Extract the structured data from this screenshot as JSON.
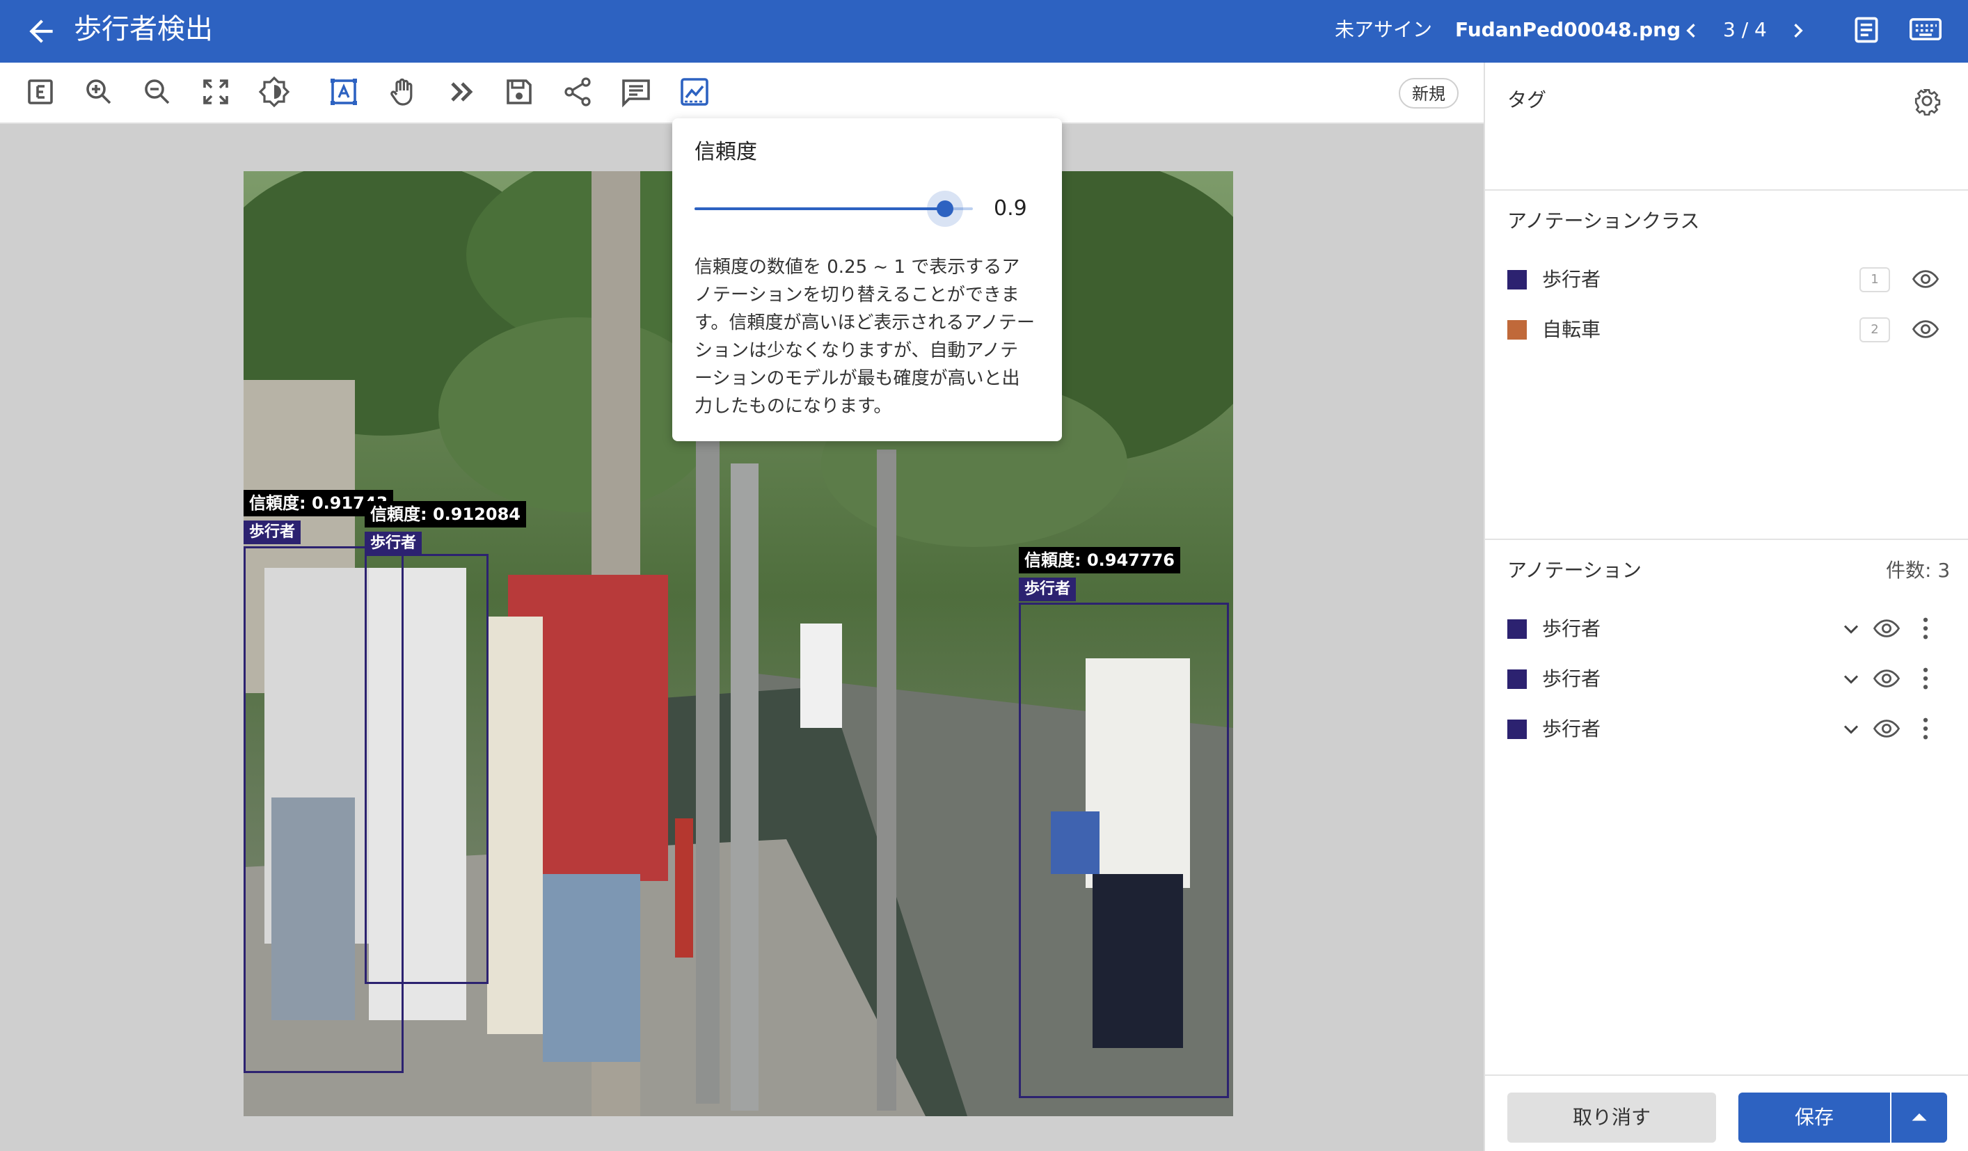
{
  "header": {
    "title": "歩行者検出",
    "assign_status": "未アサイン",
    "filename": "FudanPed00048.png",
    "pager": "3 / 4"
  },
  "toolbar": {
    "tools": [
      "e-key-icon",
      "zoom-in-icon",
      "zoom-out-icon",
      "fit-screen-icon",
      "brightness-icon",
      "text-box-icon",
      "pan-hand-icon",
      "fast-forward-icon",
      "save-disk-icon",
      "share-icon",
      "comment-icon",
      "chart-icon"
    ],
    "new_label": "新規"
  },
  "confidence_popover": {
    "title": "信頼度",
    "value": "0.9",
    "value_fraction": 0.9,
    "description": "信頼度の数値を 0.25 ~ 1 で表示するアノテーションを切り替えることができます。信頼度が高いほど表示されるアノテーションは少なくなりますが、自動アノテーションのモデルが最も確度が高いと出力したものになります。"
  },
  "image_annotations": [
    {
      "confidence": "信頼度: 0.91743",
      "label": "歩行者"
    },
    {
      "confidence": "信頼度: 0.912084",
      "label": "歩行者"
    },
    {
      "confidence": "信頼度: 0.947776",
      "label": "歩行者"
    }
  ],
  "sidebar": {
    "tags_title": "タグ",
    "classes_title": "アノテーションクラス",
    "classes": [
      {
        "name": "歩行者",
        "key": "1",
        "color": "#2c2270"
      },
      {
        "name": "自転車",
        "key": "2",
        "color": "#c0693a"
      }
    ],
    "annotations_title": "アノテーション",
    "annotations_count": "件数: 3",
    "annotations": [
      {
        "name": "歩行者",
        "color": "#2c2270"
      },
      {
        "name": "歩行者",
        "color": "#2c2270"
      },
      {
        "name": "歩行者",
        "color": "#2c2270"
      }
    ]
  },
  "footer": {
    "cancel_label": "取り消す",
    "save_label": "保存"
  },
  "colors": {
    "brand": "#2d62c1",
    "pedestrian": "#2c2270",
    "bicycle": "#c0693a"
  }
}
